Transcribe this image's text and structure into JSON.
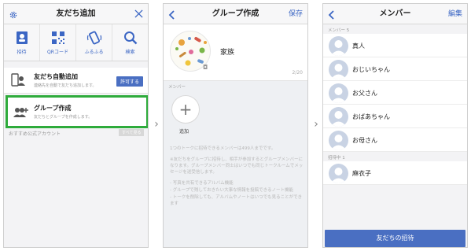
{
  "panel1": {
    "title": "友だち追加",
    "settings_icon": "gear-icon",
    "close_icon": "close-icon",
    "icons": [
      {
        "name": "invite",
        "label": "招待",
        "icon": "person-card-icon"
      },
      {
        "name": "qrcode",
        "label": "QRコード",
        "icon": "qr-code-icon"
      },
      {
        "name": "shake",
        "label": "ふるふる",
        "icon": "shake-phone-icon"
      },
      {
        "name": "search",
        "label": "検索",
        "icon": "search-icon"
      }
    ],
    "auto_add": {
      "title": "友だち自動追加",
      "subtitle": "連絡先を自動で友だち追加します。",
      "button": "許可する"
    },
    "group_create": {
      "title": "グループ作成",
      "subtitle": "友だちとグループを作成します。"
    },
    "official_accounts": "おすすめ公式アカウント",
    "see_all": "すべて見る"
  },
  "panel2": {
    "title": "グループ作成",
    "save": "保存",
    "group_name": "家族",
    "count": "2/20",
    "members_label": "メンバー",
    "invite_label": "追加",
    "note_lines": [
      "1つのトークに招待できるメンバーは499人までです。",
      "※友だちをグループに招待し、相手が参加するとグループメンバーになります。グループメンバー同士はいつでも同じトークルームでメッセージを送受信します。",
      "- 写真を共有できるアルバム機能",
      "- グループで残しておきたい大事な情報を投稿できるノート機能",
      "- トークを削除しても、アルバムやノートはいつでも見ることができます"
    ]
  },
  "panel3": {
    "title": "メンバー",
    "edit": "編集",
    "members_label": "メンバー 5",
    "members": [
      "真人",
      "おじいちゃん",
      "お父さん",
      "おばあちゃん",
      "お母さん"
    ],
    "pending_label": "招待中 1",
    "pending": [
      "麻衣子"
    ],
    "invite_button": "友だちの招待"
  },
  "colors": {
    "accent": "#4a6fc2",
    "highlight": "#2eab3b"
  }
}
